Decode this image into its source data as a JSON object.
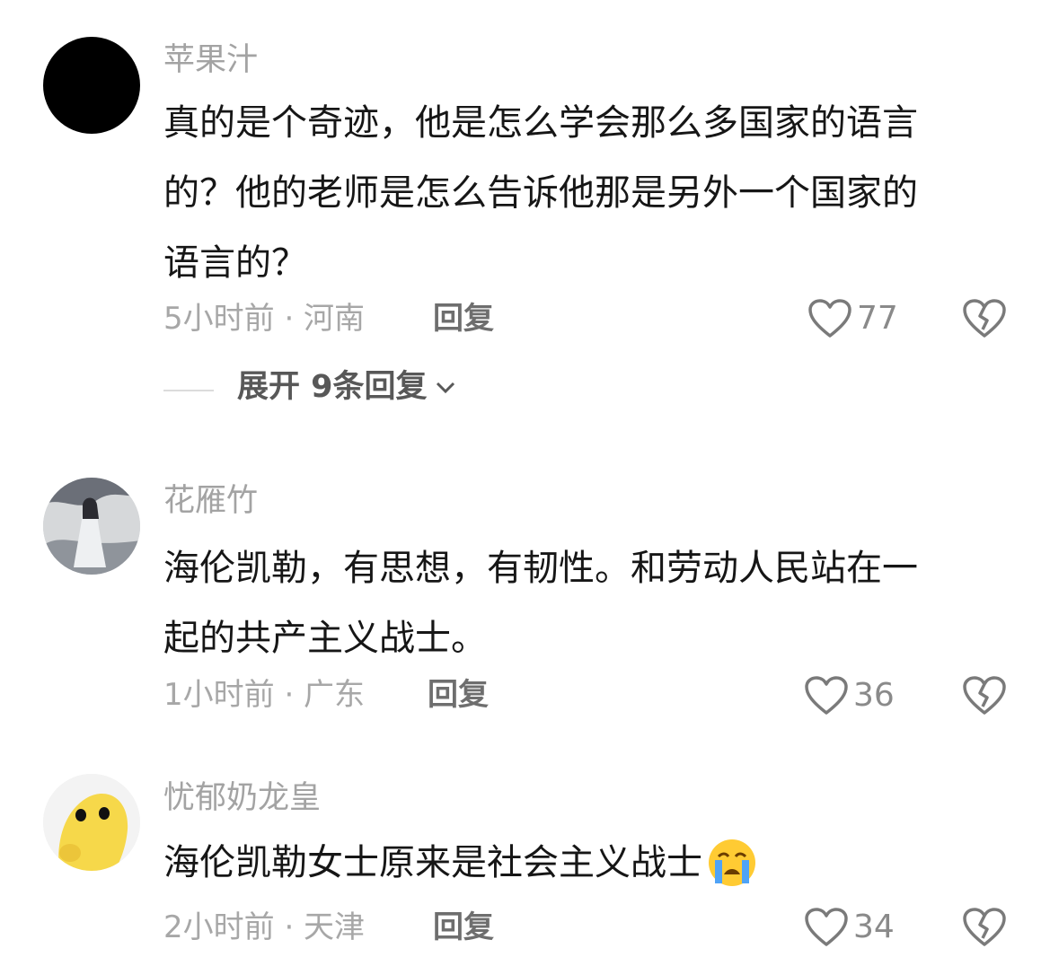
{
  "comments": [
    {
      "username": "苹果汁",
      "content_lines": [
        "真的是个奇迹，他是怎么学会那么多国家的语言",
        "的？他的老师是怎么告诉他那是另外一个国家的",
        "语言的？"
      ],
      "time_location": "5小时前 · 河南",
      "reply_label": "回复",
      "likes": "77",
      "expand_label": "展开 9条回复"
    },
    {
      "username": "花雁竹",
      "content_lines": [
        "海伦凯勒，有思想，有韧性。和劳动人民站在一",
        "起的共产主义战士。"
      ],
      "time_location": "1小时前 · 广东",
      "reply_label": "回复",
      "likes": "36"
    },
    {
      "username": "忧郁奶龙皇",
      "content_lines": [
        "海伦凯勒女士原来是社会主义战士"
      ],
      "time_location": "2小时前 · 天津",
      "reply_label": "回复",
      "likes": "34",
      "emoji": "crying-face"
    }
  ]
}
